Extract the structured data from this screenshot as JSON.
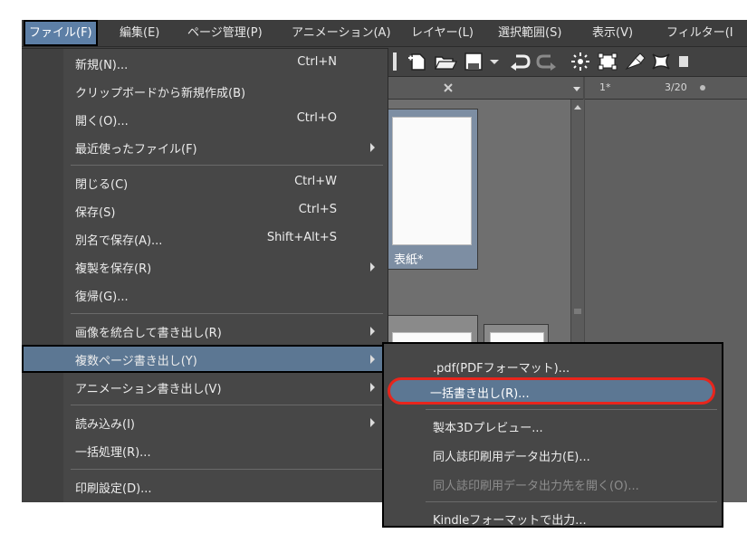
{
  "menubar": {
    "items": [
      {
        "label": "ファイル(F)"
      },
      {
        "label": "編集(E)"
      },
      {
        "label": "ページ管理(P)"
      },
      {
        "label": "アニメーション(A)"
      },
      {
        "label": "レイヤー(L)"
      },
      {
        "label": "選択範囲(S)"
      },
      {
        "label": "表示(V)"
      },
      {
        "label": "フィルター(I"
      }
    ]
  },
  "tabs": {
    "page_info": "1*",
    "page_count": "3/20"
  },
  "page_list": {
    "cover_label": "表紙*"
  },
  "file_menu": {
    "items": [
      {
        "label": "新規(N)...",
        "shortcut": "Ctrl+N"
      },
      {
        "label": "クリップボードから新規作成(B)",
        "shortcut": ""
      },
      {
        "label": "開く(O)...",
        "shortcut": "Ctrl+O"
      },
      {
        "label": "最近使ったファイル(F)",
        "shortcut": ""
      },
      {
        "label": "閉じる(C)",
        "shortcut": "Ctrl+W"
      },
      {
        "label": "保存(S)",
        "shortcut": "Ctrl+S"
      },
      {
        "label": "別名で保存(A)...",
        "shortcut": "Shift+Alt+S"
      },
      {
        "label": "複製を保存(R)",
        "shortcut": ""
      },
      {
        "label": "復帰(G)...",
        "shortcut": ""
      },
      {
        "label": "画像を統合して書き出し(R)",
        "shortcut": ""
      },
      {
        "label": "複数ページ書き出し(Y)",
        "shortcut": ""
      },
      {
        "label": "アニメーション書き出し(V)",
        "shortcut": ""
      },
      {
        "label": "読み込み(I)",
        "shortcut": ""
      },
      {
        "label": "一括処理(R)...",
        "shortcut": ""
      },
      {
        "label": "印刷設定(D)...",
        "shortcut": ""
      }
    ]
  },
  "submenu": {
    "items": [
      {
        "label": ".pdf(PDFフォーマット)..."
      },
      {
        "label": "一括書き出し(R)..."
      },
      {
        "label": "製本3Dプレビュー..."
      },
      {
        "label": "同人誌印刷用データ出力(E)..."
      },
      {
        "label": "同人誌印刷用データ出力先を開く(O)..."
      },
      {
        "label": "Kindleフォーマットで出力..."
      }
    ]
  },
  "colors": {
    "highlight": "#5c7793",
    "callout_red": "#e8251c"
  }
}
